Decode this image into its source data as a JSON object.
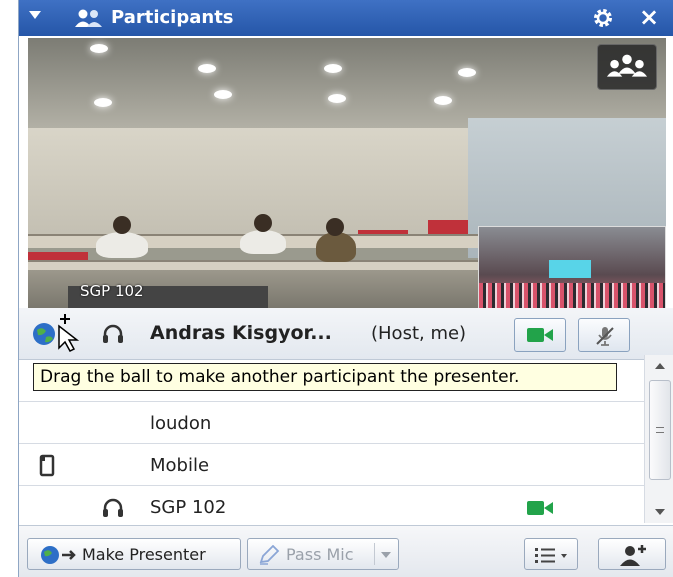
{
  "window": {
    "title": "Participants"
  },
  "video": {
    "label": "SGP 102"
  },
  "self": {
    "name": "Andras Kisgyor...",
    "role": "(Host, me)"
  },
  "tooltip": {
    "text": "Drag the ball to make another participant the presenter."
  },
  "participants": [
    {
      "name": "loudon",
      "connection": "none"
    },
    {
      "name": "Mobile",
      "connection": "mobile-icon"
    },
    {
      "name": "SGP 102",
      "connection": "headset-icon",
      "video": true
    }
  ],
  "toolbar": {
    "make_presenter": "Make Presenter",
    "pass_mic": "Pass Mic"
  },
  "colors": {
    "titlebar": "#2e60b3",
    "video_on": "#22a34a",
    "tooltip_bg": "#ffffe1"
  }
}
